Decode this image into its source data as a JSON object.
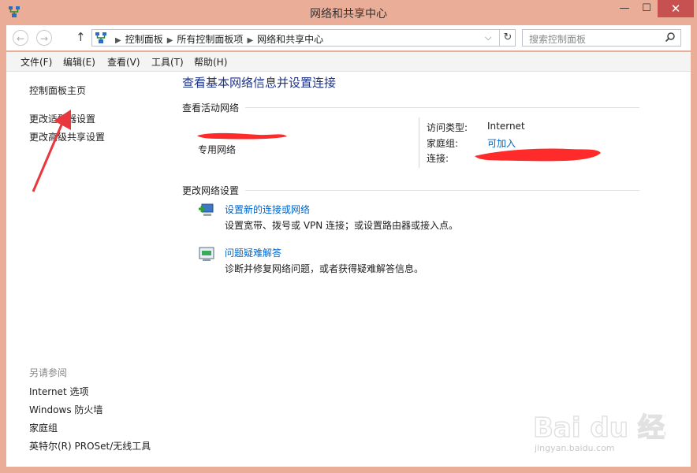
{
  "window": {
    "title": "网络和共享中心"
  },
  "titlebar_buttons": {
    "minimize": "—",
    "maximize": "☐",
    "close": "✕"
  },
  "address": {
    "crumbs": [
      "控制面板",
      "所有控制面板项",
      "网络和共享中心"
    ],
    "dropdown": "⌵",
    "refresh": "↻"
  },
  "nav": {
    "back": "←",
    "forward": "→",
    "up": "↑"
  },
  "search": {
    "placeholder": "搜索控制面板",
    "icon": "search-icon"
  },
  "menu": [
    "文件(F)",
    "编辑(E)",
    "查看(V)",
    "工具(T)",
    "帮助(H)"
  ],
  "sidebar": {
    "links": [
      "控制面板主页",
      "更改适配器设置",
      "更改高级共享设置"
    ],
    "see_also_heading": "另请参阅",
    "see_also": [
      "Internet 选项",
      "Windows 防火墙",
      "家庭组",
      "英特尔(R) PROSet/无线工具"
    ]
  },
  "main": {
    "title": "查看基本网络信息并设置连接",
    "active_section": "查看活动网络",
    "network_type": "专用网络",
    "props": [
      {
        "label": "访问类型:",
        "value": "Internet"
      },
      {
        "label": "家庭组:",
        "value": "可加入"
      },
      {
        "label": "连接:",
        "value": ""
      }
    ],
    "change_section": "更改网络设置",
    "tasks": [
      {
        "link": "设置新的连接或网络",
        "desc": "设置宽带、拨号或 VPN 连接；或设置路由器或接入点。",
        "icon": "new-connection-icon"
      },
      {
        "link": "问题疑难解答",
        "desc": "诊断并修复网络问题，或者获得疑难解答信息。",
        "icon": "troubleshoot-icon"
      }
    ]
  },
  "watermark": {
    "text": "Bai du 经验",
    "url": "jingyan.baidu.com"
  },
  "colors": {
    "frame": "#e9ad98",
    "close": "#c75050",
    "title_blue": "#1e3287",
    "link": "#0066cc",
    "scribble": "#ff2a2a",
    "arrow": "#e8383d"
  }
}
